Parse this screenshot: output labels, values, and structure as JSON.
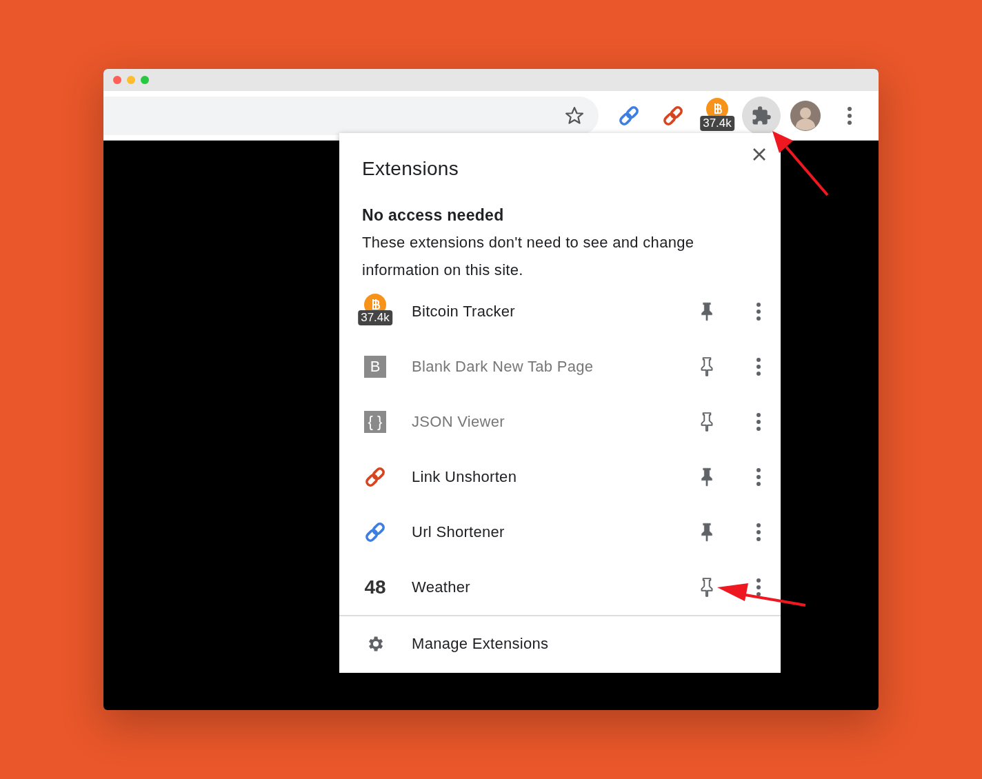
{
  "toolbar": {
    "extensions_button": {
      "highlighted": true
    },
    "actions": [
      {
        "kind": "chain",
        "color": "#3d7ee0"
      },
      {
        "kind": "chain",
        "color": "#d54520"
      },
      {
        "kind": "bitcoin",
        "badge": "37.4k"
      }
    ]
  },
  "popup": {
    "title": "Extensions",
    "section_heading": "No access needed",
    "section_text": "These extensions don't need to see and change information on this site.",
    "extensions": [
      {
        "name": "Bitcoin Tracker",
        "icon": {
          "kind": "bitcoin",
          "badge": "37.4k"
        },
        "enabled": true,
        "pinned": true
      },
      {
        "name": "Blank Dark New Tab Page",
        "icon": {
          "kind": "tile",
          "text": "B"
        },
        "enabled": false,
        "pinned": false
      },
      {
        "name": "JSON Viewer",
        "icon": {
          "kind": "tile",
          "text": "{ }"
        },
        "enabled": false,
        "pinned": false
      },
      {
        "name": "Link Unshorten",
        "icon": {
          "kind": "chain",
          "color": "#d54520"
        },
        "enabled": true,
        "pinned": true
      },
      {
        "name": "Url Shortener",
        "icon": {
          "kind": "chain",
          "color": "#3d7ee0"
        },
        "enabled": true,
        "pinned": true
      },
      {
        "name": "Weather",
        "icon": {
          "kind": "text",
          "text": "48"
        },
        "enabled": true,
        "pinned": false
      }
    ],
    "manage_label": "Manage Extensions"
  }
}
